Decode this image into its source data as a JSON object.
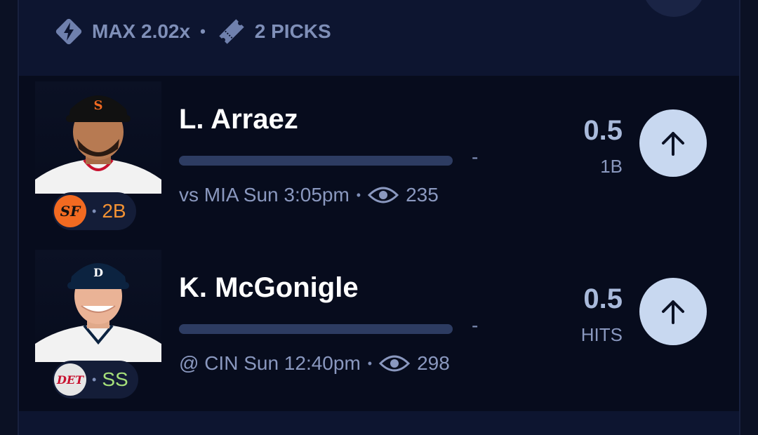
{
  "header": {
    "multiplier_label": "MAX 2.02x",
    "picks_label": "2 PICKS"
  },
  "players": [
    {
      "name": "L. Arraez",
      "team": "SF",
      "position": "2B",
      "matchup": "vs MIA Sun 3:05pm",
      "views": "235",
      "line": "0.5",
      "stat": "1B",
      "progress_value": "-",
      "team_color": "#f26a21",
      "position_color": "#f39233"
    },
    {
      "name": "K. McGonigle",
      "team": "DET",
      "position": "SS",
      "matchup": "@ CIN Sun 12:40pm",
      "views": "298",
      "line": "0.5",
      "stat": "HITS",
      "progress_value": "-",
      "team_color": "#0c2340",
      "position_color": "#a6e07a"
    }
  ],
  "icons": {
    "multiplier": "lightning-diamond-icon",
    "picks": "ticket-icon",
    "views": "eye-icon",
    "pick_more": "arrow-up-icon"
  }
}
